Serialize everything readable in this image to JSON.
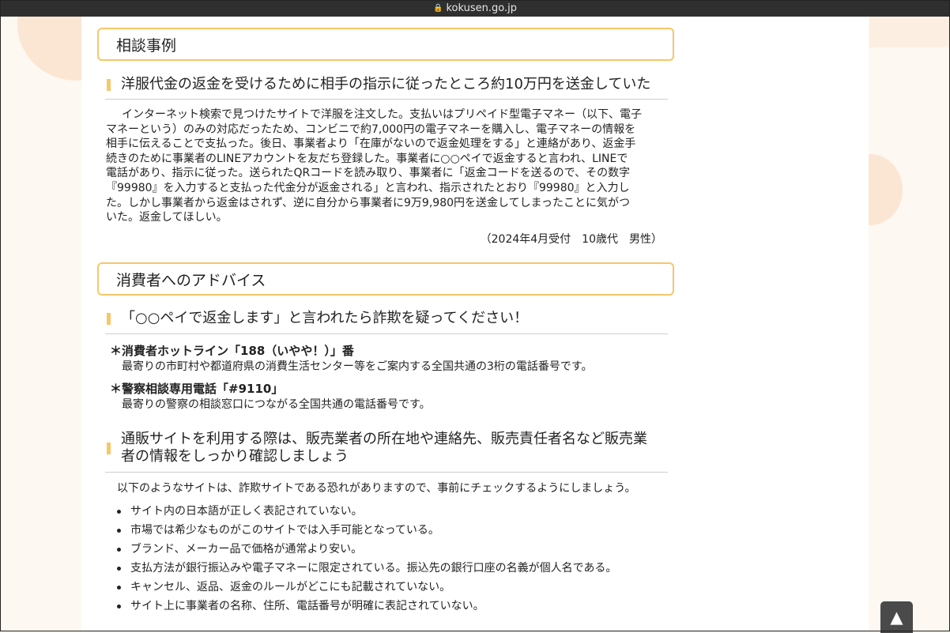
{
  "browser": {
    "url": "kokusen.go.jp"
  },
  "sections": {
    "case": {
      "title": "相談事例",
      "subhead": "洋服代金の返金を受けるために相手の指示に従ったところ約10万円を送金していた",
      "body_lines": [
        "インターネット検索で見つけたサイトで洋服を注文した。支払いはプリペイド型電子マネー（以下、電子",
        "マネーという）のみの対応だったため、コンビニで約7,000円の電子マネーを購入し、電子マネーの情報を",
        "相手に伝えることで支払った。後日、事業者より「在庫がないので返金処理をする」と連絡があり、返金手",
        "続きのために事業者のLINEアカウントを友だち登録した。事業者に○○ペイで返金すると言われ、LINEで",
        "電話があり、指示に従った。送られたQRコードを読み取り、事業者に「返金コードを送るので、その数字",
        "『99980』を入力すると支払った代金分が返金される」と言われ、指示されたとおり『99980』と入力し",
        "た。しかし事業者から返金はされず、逆に自分から事業者に9万9,980円を送金してしまったことに気がつ",
        "いた。返金してほしい。"
      ],
      "note": "（2024年4月受付　10歳代　男性）"
    },
    "advice": {
      "title": "消費者へのアドバイス",
      "subhead1": "「○○ペイで返金します」と言われたら詐欺を疑ってください！",
      "hotline_title": "＊消費者ホットライン「188（いやや！）」番",
      "hotline_desc": "最寄りの市町村や都道府県の消費生活センター等をご案内する全国共通の3桁の電話番号です。",
      "police_title": "＊警察相談専用電話「#9110」",
      "police_desc": "最寄りの警察の相談窓口につながる全国共通の電話番号です。",
      "subhead2_line1": "通販サイトを利用する際は、販売業者の所在地や連絡先、販売責任者名など販売業",
      "subhead2_line2": "者の情報をしっかり確認しましょう",
      "intro": "以下のようなサイトは、詐欺サイトである恐れがありますので、事前にチェックするようにしましょう。",
      "bullets": [
        "サイト内の日本語が正しく表記されていない。",
        "市場では希少なものがこのサイトでは入手可能となっている。",
        "ブランド、メーカー品で価格が通常より安い。",
        "支払方法が銀行振込みや電子マネーに限定されている。振込先の銀行口座の名義が個人名である。",
        "キャンセル、返品、返金のルールがどこにも記載されていない。",
        "サイト上に事業者の名称、住所、電話番号が明確に表記されていない。"
      ]
    }
  },
  "back_to_top": "▲"
}
